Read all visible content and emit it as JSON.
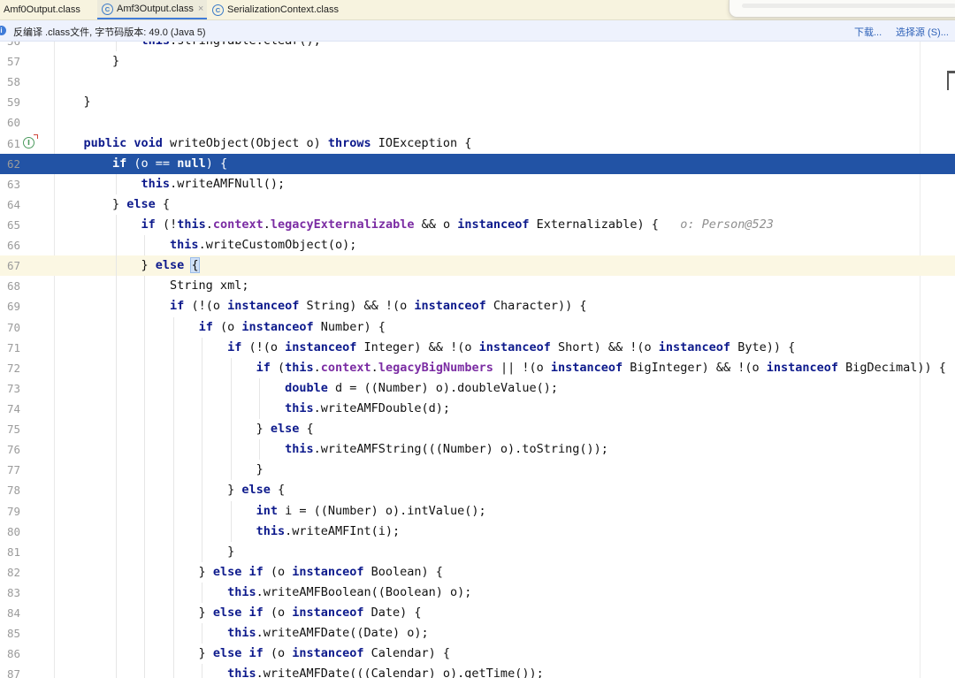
{
  "tabs": [
    {
      "label": "Amf0Output.class",
      "icon": "class-icon",
      "active": false
    },
    {
      "label": "Amf3Output.class",
      "icon": "class-icon",
      "active": true
    },
    {
      "label": "SerializationContext.class",
      "icon": "class-icon",
      "active": false
    }
  ],
  "tab_close_glyph": "×",
  "tab_icon_glyph": "C",
  "banner": {
    "icon_glyph": "i",
    "text": "反编译 .class文件, 字节码版本: 49.0 (Java 5)",
    "download_label": "下载...",
    "choose_source_label": "选择源 (S)..."
  },
  "gutter": {
    "override_icon_glyph": "I"
  },
  "editor": {
    "highlight_color": "#2253a5",
    "current_line_color": "#fbf7e3",
    "lines": [
      {
        "num": "56",
        "segs": [
          [
            "",
            "            "
          ],
          [
            "kw",
            "this"
          ],
          [
            "",
            ".stringTable.clear();"
          ]
        ]
      },
      {
        "num": "57",
        "segs": [
          [
            "",
            "        }"
          ]
        ]
      },
      {
        "num": "58",
        "segs": []
      },
      {
        "num": "59",
        "segs": [
          [
            "",
            "    }"
          ]
        ]
      },
      {
        "num": "60",
        "segs": []
      },
      {
        "num": "61",
        "icon": true,
        "segs": [
          [
            "",
            "    "
          ],
          [
            "kw",
            "public void"
          ],
          [
            "",
            " writeObject(Object o) "
          ],
          [
            "kw",
            "throws"
          ],
          [
            "",
            " IOException {"
          ]
        ]
      },
      {
        "num": "62",
        "state": "highlight",
        "segs": [
          [
            "",
            "        "
          ],
          [
            "kw",
            "if"
          ],
          [
            "",
            " (o == "
          ],
          [
            "kw",
            "null"
          ],
          [
            "",
            ") {"
          ]
        ]
      },
      {
        "num": "63",
        "segs": [
          [
            "",
            "            "
          ],
          [
            "kw",
            "this"
          ],
          [
            "",
            ".writeAMFNull();"
          ]
        ]
      },
      {
        "num": "64",
        "segs": [
          [
            "",
            "        } "
          ],
          [
            "kw",
            "else"
          ],
          [
            "",
            " {"
          ]
        ]
      },
      {
        "num": "65",
        "segs": [
          [
            "",
            "            "
          ],
          [
            "kw",
            "if"
          ],
          [
            "",
            " (!"
          ],
          [
            "kw",
            "this"
          ],
          [
            "",
            "."
          ],
          [
            "fld",
            "context"
          ],
          [
            "",
            "."
          ],
          [
            "fld",
            "legacyExternalizable"
          ],
          [
            "",
            " && o "
          ],
          [
            "kw",
            "instanceof"
          ],
          [
            "",
            " Externalizable) {   "
          ],
          [
            "hint",
            "o: Person@523"
          ]
        ]
      },
      {
        "num": "66",
        "segs": [
          [
            "",
            "                "
          ],
          [
            "kw",
            "this"
          ],
          [
            "",
            ".writeCustomObject(o);"
          ]
        ]
      },
      {
        "num": "67",
        "state": "current",
        "segs": [
          [
            "",
            "            } "
          ],
          [
            "kw",
            "else"
          ],
          [
            "",
            " "
          ],
          [
            "brace",
            "{"
          ]
        ]
      },
      {
        "num": "68",
        "segs": [
          [
            "",
            "                String xml;"
          ]
        ]
      },
      {
        "num": "69",
        "segs": [
          [
            "",
            "                "
          ],
          [
            "kw",
            "if"
          ],
          [
            "",
            " (!(o "
          ],
          [
            "kw",
            "instanceof"
          ],
          [
            "",
            " String) && !(o "
          ],
          [
            "kw",
            "instanceof"
          ],
          [
            "",
            " Character)) {"
          ]
        ]
      },
      {
        "num": "70",
        "segs": [
          [
            "",
            "                    "
          ],
          [
            "kw",
            "if"
          ],
          [
            "",
            " (o "
          ],
          [
            "kw",
            "instanceof"
          ],
          [
            "",
            " Number) {"
          ]
        ]
      },
      {
        "num": "71",
        "segs": [
          [
            "",
            "                        "
          ],
          [
            "kw",
            "if"
          ],
          [
            "",
            " (!(o "
          ],
          [
            "kw",
            "instanceof"
          ],
          [
            "",
            " Integer) && !(o "
          ],
          [
            "kw",
            "instanceof"
          ],
          [
            "",
            " Short) && !(o "
          ],
          [
            "kw",
            "instanceof"
          ],
          [
            "",
            " Byte)) {"
          ]
        ]
      },
      {
        "num": "72",
        "segs": [
          [
            "",
            "                            "
          ],
          [
            "kw",
            "if"
          ],
          [
            "",
            " ("
          ],
          [
            "kw",
            "this"
          ],
          [
            "",
            "."
          ],
          [
            "fld",
            "context"
          ],
          [
            "",
            "."
          ],
          [
            "fld",
            "legacyBigNumbers"
          ],
          [
            "",
            " || !(o "
          ],
          [
            "kw",
            "instanceof"
          ],
          [
            "",
            " BigInteger) && !(o "
          ],
          [
            "kw",
            "instanceof"
          ],
          [
            "",
            " BigDecimal)) {"
          ]
        ]
      },
      {
        "num": "73",
        "segs": [
          [
            "",
            "                                "
          ],
          [
            "kw",
            "double"
          ],
          [
            "",
            " d = ((Number) o).doubleValue();"
          ]
        ]
      },
      {
        "num": "74",
        "segs": [
          [
            "",
            "                                "
          ],
          [
            "kw",
            "this"
          ],
          [
            "",
            ".writeAMFDouble(d);"
          ]
        ]
      },
      {
        "num": "75",
        "segs": [
          [
            "",
            "                            } "
          ],
          [
            "kw",
            "else"
          ],
          [
            "",
            " {"
          ]
        ]
      },
      {
        "num": "76",
        "segs": [
          [
            "",
            "                                "
          ],
          [
            "kw",
            "this"
          ],
          [
            "",
            ".writeAMFString(((Number) o).toString());"
          ]
        ]
      },
      {
        "num": "77",
        "segs": [
          [
            "",
            "                            }"
          ]
        ]
      },
      {
        "num": "78",
        "segs": [
          [
            "",
            "                        } "
          ],
          [
            "kw",
            "else"
          ],
          [
            "",
            " {"
          ]
        ]
      },
      {
        "num": "79",
        "segs": [
          [
            "",
            "                            "
          ],
          [
            "kw",
            "int"
          ],
          [
            "",
            " i = ((Number) o).intValue();"
          ]
        ]
      },
      {
        "num": "80",
        "segs": [
          [
            "",
            "                            "
          ],
          [
            "kw",
            "this"
          ],
          [
            "",
            ".writeAMFInt(i);"
          ]
        ]
      },
      {
        "num": "81",
        "segs": [
          [
            "",
            "                        }"
          ]
        ]
      },
      {
        "num": "82",
        "segs": [
          [
            "",
            "                    } "
          ],
          [
            "kw",
            "else if"
          ],
          [
            "",
            " (o "
          ],
          [
            "kw",
            "instanceof"
          ],
          [
            "",
            " Boolean) {"
          ]
        ]
      },
      {
        "num": "83",
        "segs": [
          [
            "",
            "                        "
          ],
          [
            "kw",
            "this"
          ],
          [
            "",
            ".writeAMFBoolean((Boolean) o);"
          ]
        ]
      },
      {
        "num": "84",
        "segs": [
          [
            "",
            "                    } "
          ],
          [
            "kw",
            "else if"
          ],
          [
            "",
            " (o "
          ],
          [
            "kw",
            "instanceof"
          ],
          [
            "",
            " Date) {"
          ]
        ]
      },
      {
        "num": "85",
        "segs": [
          [
            "",
            "                        "
          ],
          [
            "kw",
            "this"
          ],
          [
            "",
            ".writeAMFDate((Date) o);"
          ]
        ]
      },
      {
        "num": "86",
        "segs": [
          [
            "",
            "                    } "
          ],
          [
            "kw",
            "else if"
          ],
          [
            "",
            " (o "
          ],
          [
            "kw",
            "instanceof"
          ],
          [
            "",
            " Calendar) {"
          ]
        ]
      },
      {
        "num": "87",
        "segs": [
          [
            "",
            "                        "
          ],
          [
            "kw",
            "this"
          ],
          [
            "",
            ".writeAMFDate(((Calendar) o).getTime());"
          ]
        ]
      }
    ]
  }
}
